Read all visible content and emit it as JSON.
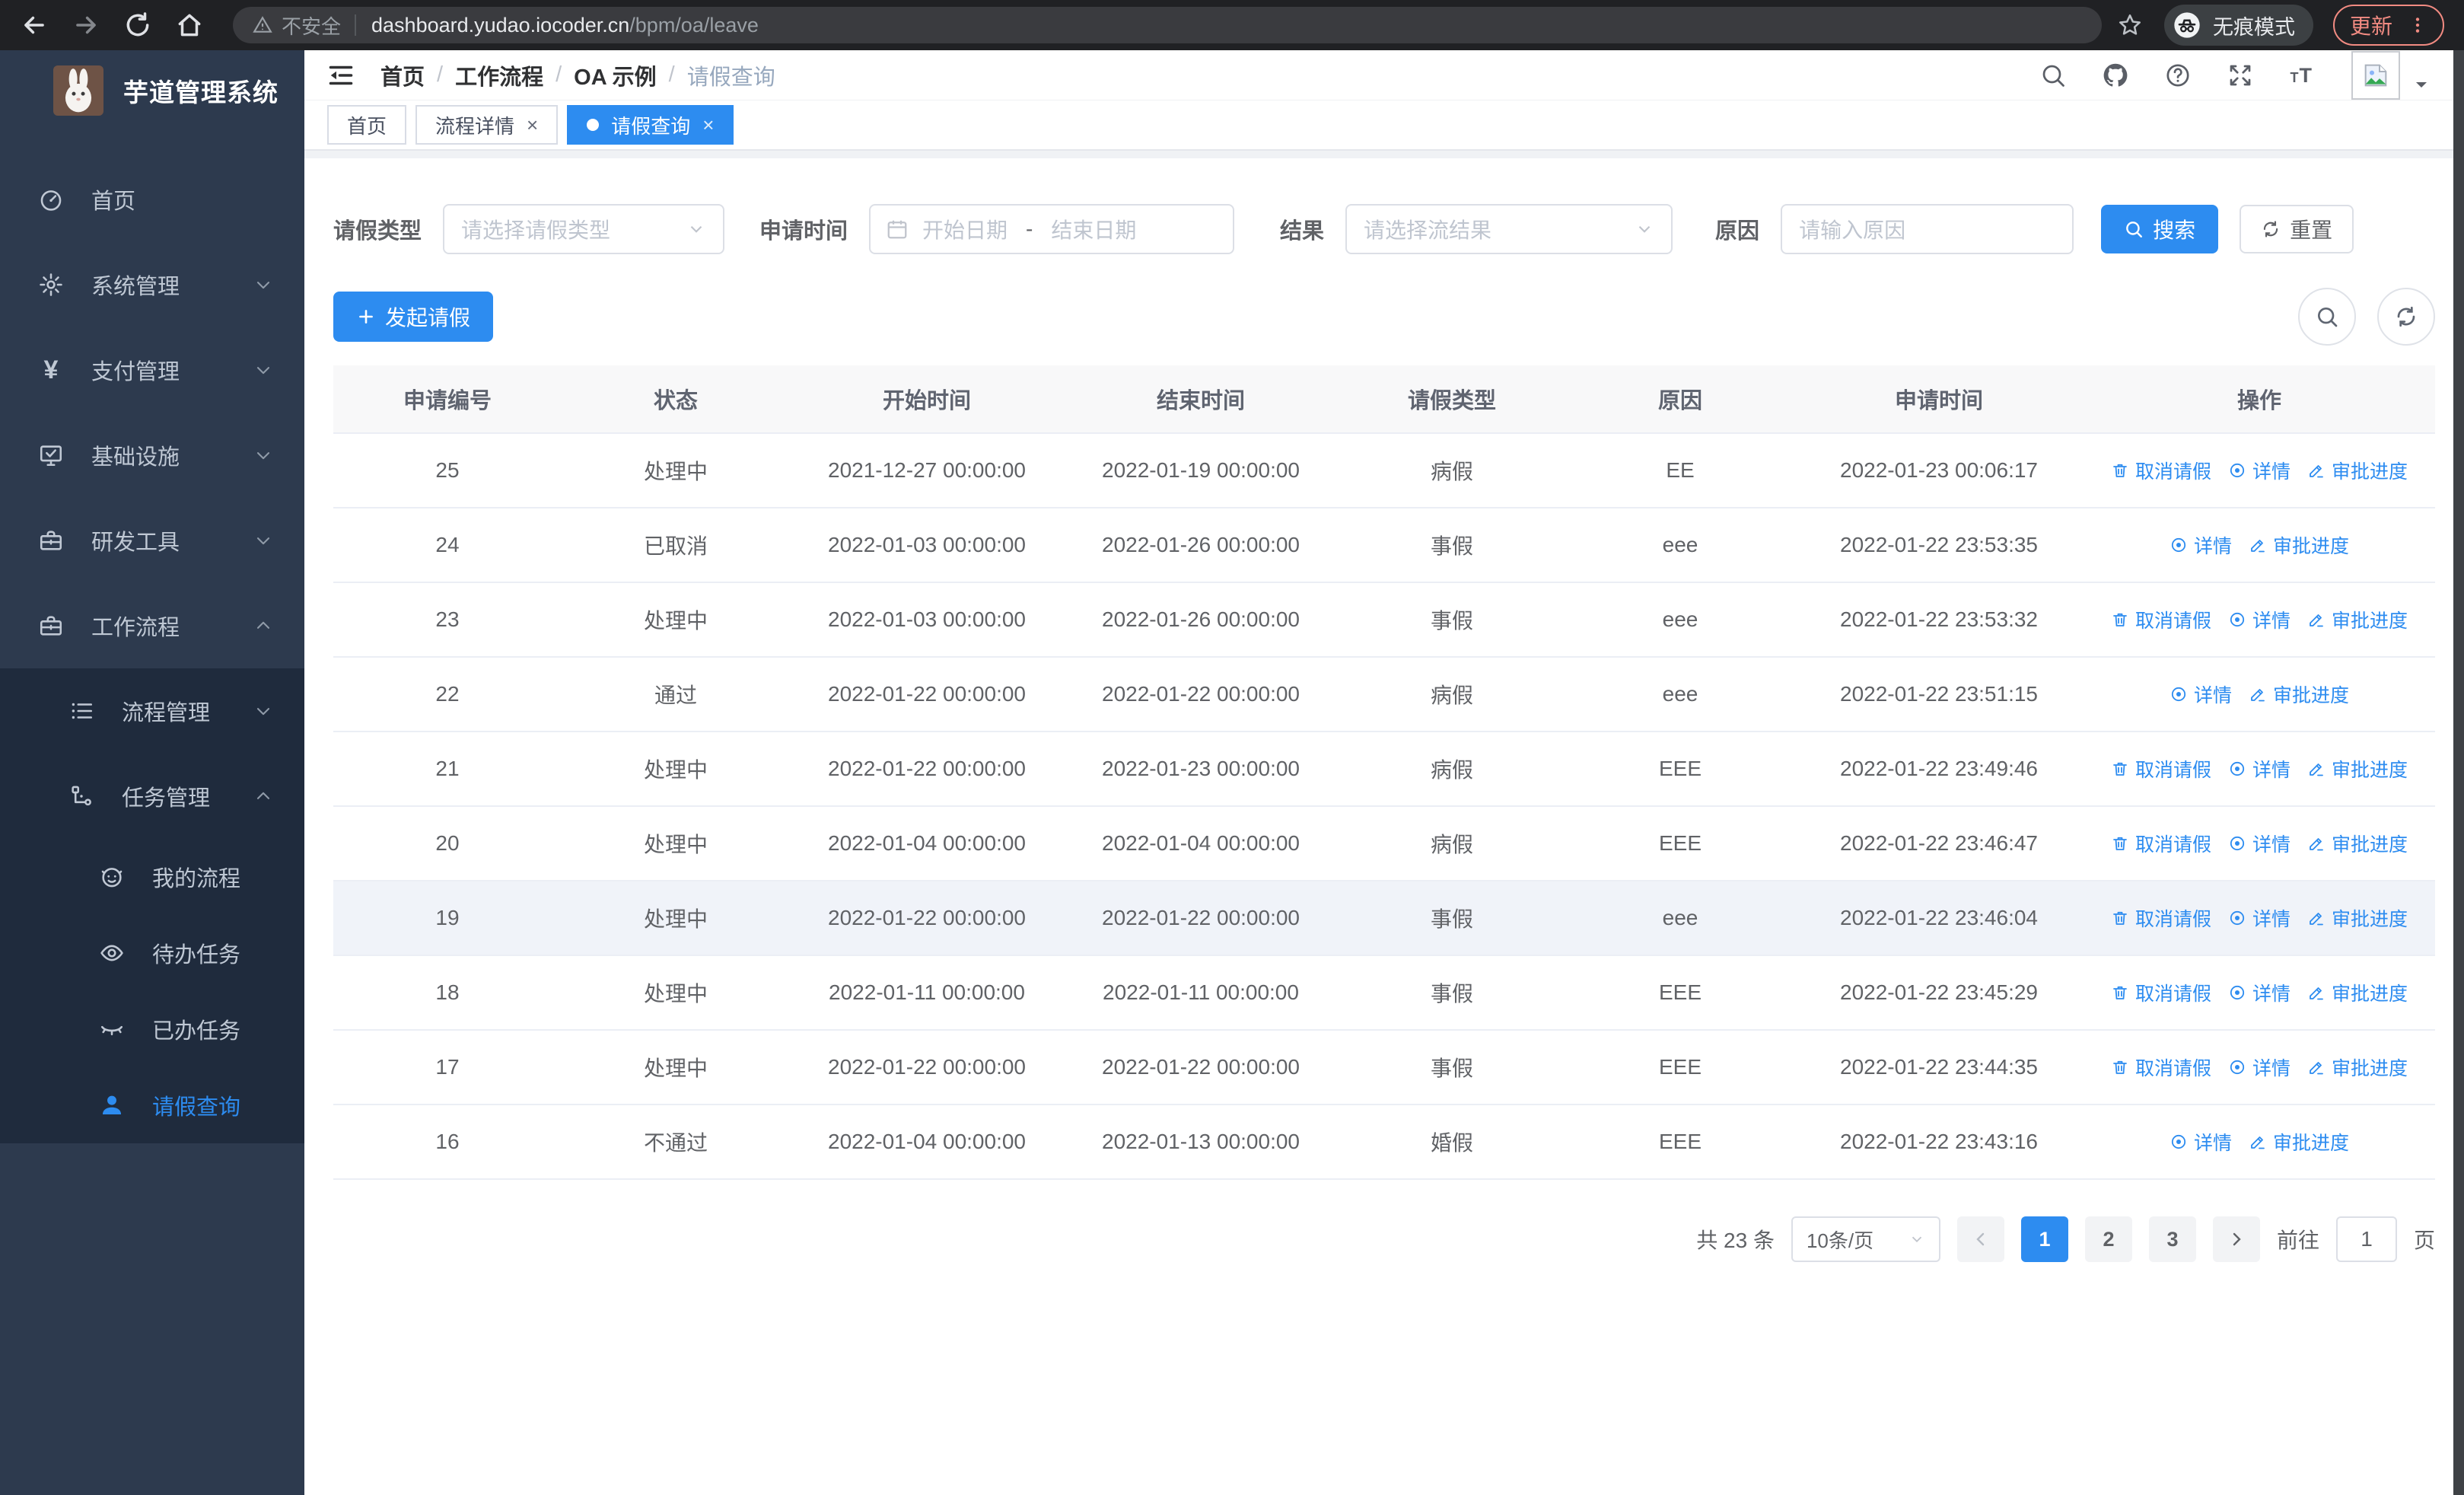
{
  "colors": {
    "accent": "#2d8cf0",
    "sidebar_bg": "#2d3a4e",
    "submenu_bg": "#1f2b3d",
    "chrome_bg": "#202124",
    "update_accent": "#f28b82",
    "row_highlight": "#f0f3f9",
    "table_header_bg": "#f8f8f9"
  },
  "browser": {
    "security_label": "不安全",
    "url_host": "dashboard.yudao.iocoder.cn",
    "url_path": "/bpm/oa/leave",
    "incognito_label": "无痕模式",
    "update_label": "更新"
  },
  "app": {
    "title": "芋道管理系统"
  },
  "sidebar": {
    "items": [
      {
        "key": "home",
        "label": "首页",
        "icon": "dashboard-icon",
        "level": 1
      },
      {
        "key": "system-management",
        "label": "系统管理",
        "icon": "gear-icon",
        "level": 1,
        "chevron": "down"
      },
      {
        "key": "payment-management",
        "label": "支付管理",
        "icon": "yen-icon",
        "level": 1,
        "chevron": "down"
      },
      {
        "key": "infrastructure",
        "label": "基础设施",
        "icon": "monitor-icon",
        "level": 1,
        "chevron": "down"
      },
      {
        "key": "dev-tools",
        "label": "研发工具",
        "icon": "briefcase-icon",
        "level": 1,
        "chevron": "down"
      },
      {
        "key": "workflow",
        "label": "工作流程",
        "icon": "briefcase-icon",
        "level": 1,
        "chevron": "up",
        "children": [
          {
            "key": "process-management",
            "label": "流程管理",
            "icon": "list-icon",
            "level": 2,
            "chevron": "down"
          },
          {
            "key": "task-management",
            "label": "任务管理",
            "icon": "flow-icon",
            "level": 2,
            "chevron": "up",
            "children": [
              {
                "key": "my-process",
                "label": "我的流程",
                "icon": "robot-icon",
                "level": 3
              },
              {
                "key": "todo-tasks",
                "label": "待办任务",
                "icon": "eye-icon",
                "level": 3
              },
              {
                "key": "done-tasks",
                "label": "已办任务",
                "icon": "eye-closed-icon",
                "level": 3
              },
              {
                "key": "leave-query",
                "label": "请假查询",
                "icon": "user-icon",
                "level": 3,
                "active": true
              }
            ]
          }
        ]
      }
    ]
  },
  "header": {
    "breadcrumb": [
      "首页",
      "工作流程",
      "OA 示例",
      "请假查询"
    ],
    "icons": [
      {
        "key": "search",
        "icon": "search-icon"
      },
      {
        "key": "github",
        "icon": "github-icon"
      },
      {
        "key": "help",
        "icon": "question-icon"
      },
      {
        "key": "fullscreen",
        "icon": "fullscreen-icon"
      },
      {
        "key": "font-size",
        "icon": "font-size-icon"
      }
    ]
  },
  "tabs": [
    {
      "key": "home",
      "label": "首页",
      "closable": false,
      "active": false
    },
    {
      "key": "process-detail",
      "label": "流程详情",
      "closable": true,
      "active": false
    },
    {
      "key": "leave-query",
      "label": "请假查询",
      "closable": true,
      "active": true
    }
  ],
  "filters": {
    "type_label": "请假类型",
    "type_placeholder": "请选择请假类型",
    "time_label": "申请时间",
    "start_placeholder": "开始日期",
    "range_separator": "-",
    "end_placeholder": "结束日期",
    "result_label": "结果",
    "result_placeholder": "请选择流结果",
    "reason_label": "原因",
    "reason_placeholder": "请输入原因",
    "search_label": "搜索",
    "reset_label": "重置"
  },
  "toolbar": {
    "create_label": "发起请假"
  },
  "table": {
    "columns": [
      "申请编号",
      "状态",
      "开始时间",
      "结束时间",
      "请假类型",
      "原因",
      "申请时间",
      "操作"
    ],
    "action_labels": {
      "cancel": "取消请假",
      "detail": "详情",
      "progress": "审批进度"
    },
    "action_icons": {
      "cancel": "trash-icon",
      "detail": "view-icon",
      "progress": "edit-icon"
    },
    "rows": [
      {
        "id": "25",
        "status": "处理中",
        "start": "2021-12-27 00:00:00",
        "end": "2022-01-19 00:00:00",
        "type": "病假",
        "reason": "EE",
        "applied": "2022-01-23 00:06:17",
        "actions": [
          "cancel",
          "detail",
          "progress"
        ],
        "highlight": false
      },
      {
        "id": "24",
        "status": "已取消",
        "start": "2022-01-03 00:00:00",
        "end": "2022-01-26 00:00:00",
        "type": "事假",
        "reason": "eee",
        "applied": "2022-01-22 23:53:35",
        "actions": [
          "detail",
          "progress"
        ],
        "highlight": false
      },
      {
        "id": "23",
        "status": "处理中",
        "start": "2022-01-03 00:00:00",
        "end": "2022-01-26 00:00:00",
        "type": "事假",
        "reason": "eee",
        "applied": "2022-01-22 23:53:32",
        "actions": [
          "cancel",
          "detail",
          "progress"
        ],
        "highlight": false
      },
      {
        "id": "22",
        "status": "通过",
        "start": "2022-01-22 00:00:00",
        "end": "2022-01-22 00:00:00",
        "type": "病假",
        "reason": "eee",
        "applied": "2022-01-22 23:51:15",
        "actions": [
          "detail",
          "progress"
        ],
        "highlight": false
      },
      {
        "id": "21",
        "status": "处理中",
        "start": "2022-01-22 00:00:00",
        "end": "2022-01-23 00:00:00",
        "type": "病假",
        "reason": "EEE",
        "applied": "2022-01-22 23:49:46",
        "actions": [
          "cancel",
          "detail",
          "progress"
        ],
        "highlight": false
      },
      {
        "id": "20",
        "status": "处理中",
        "start": "2022-01-04 00:00:00",
        "end": "2022-01-04 00:00:00",
        "type": "病假",
        "reason": "EEE",
        "applied": "2022-01-22 23:46:47",
        "actions": [
          "cancel",
          "detail",
          "progress"
        ],
        "highlight": false
      },
      {
        "id": "19",
        "status": "处理中",
        "start": "2022-01-22 00:00:00",
        "end": "2022-01-22 00:00:00",
        "type": "事假",
        "reason": "eee",
        "applied": "2022-01-22 23:46:04",
        "actions": [
          "cancel",
          "detail",
          "progress"
        ],
        "highlight": true
      },
      {
        "id": "18",
        "status": "处理中",
        "start": "2022-01-11 00:00:00",
        "end": "2022-01-11 00:00:00",
        "type": "事假",
        "reason": "EEE",
        "applied": "2022-01-22 23:45:29",
        "actions": [
          "cancel",
          "detail",
          "progress"
        ],
        "highlight": false
      },
      {
        "id": "17",
        "status": "处理中",
        "start": "2022-01-22 00:00:00",
        "end": "2022-01-22 00:00:00",
        "type": "事假",
        "reason": "EEE",
        "applied": "2022-01-22 23:44:35",
        "actions": [
          "cancel",
          "detail",
          "progress"
        ],
        "highlight": false
      },
      {
        "id": "16",
        "status": "不通过",
        "start": "2022-01-04 00:00:00",
        "end": "2022-01-13 00:00:00",
        "type": "婚假",
        "reason": "EEE",
        "applied": "2022-01-22 23:43:16",
        "actions": [
          "detail",
          "progress"
        ],
        "highlight": false
      }
    ]
  },
  "pagination": {
    "total_label": "共 23 条",
    "page_size_label": "10条/页",
    "pages": [
      "1",
      "2",
      "3"
    ],
    "active_page": "1",
    "goto_label": "前往",
    "goto_value": "1",
    "page_suffix_label": "页"
  }
}
